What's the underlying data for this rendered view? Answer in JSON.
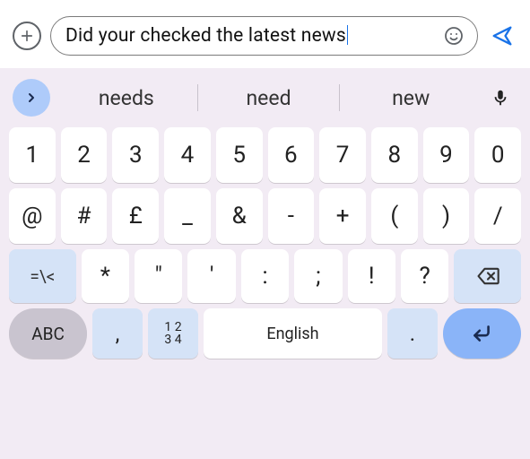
{
  "input": {
    "plain1": "Did ",
    "underlined1": "your checked",
    "plain2": " the latest ",
    "underlined2": "news"
  },
  "suggestions": {
    "s0": "needs",
    "s1": "need",
    "s2": "new"
  },
  "rows": {
    "r1": [
      "1",
      "2",
      "3",
      "4",
      "5",
      "6",
      "7",
      "8",
      "9",
      "0"
    ],
    "r2": [
      "@",
      "#",
      "£",
      "_",
      "&",
      "-",
      "+",
      "(",
      ")",
      "/"
    ],
    "r3_mod": "=\\<",
    "r3": [
      "*",
      "\"",
      "'",
      ":",
      ";",
      "!",
      "?"
    ],
    "abc": "ABC",
    "comma": ",",
    "numpad1": "1 2",
    "numpad2": "3 4",
    "space": "English",
    "period": "."
  }
}
